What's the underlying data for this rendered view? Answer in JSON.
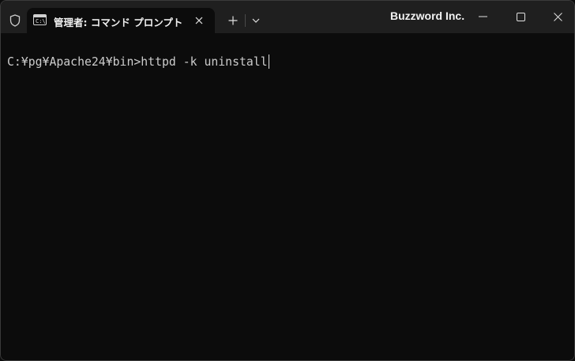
{
  "titlebar": {
    "tab_title": "管理者: コマンド プロンプト",
    "tab_icon_text": "C:\\",
    "brand": "Buzzword Inc."
  },
  "terminal": {
    "prompt": "C:¥pg¥Apache24¥bin>",
    "command": "httpd -k uninstall"
  },
  "icons": {
    "shield": "shield-icon",
    "tab_icon": "command-prompt-icon",
    "tab_close": "close-icon",
    "new_tab": "plus-icon",
    "dropdown": "chevron-down-icon",
    "minimize": "minimize-icon",
    "maximize": "maximize-icon",
    "close": "close-icon"
  },
  "colors": {
    "titlebar_bg": "#1f1f1f",
    "terminal_bg": "#0c0c0c",
    "text": "#cccccc"
  }
}
